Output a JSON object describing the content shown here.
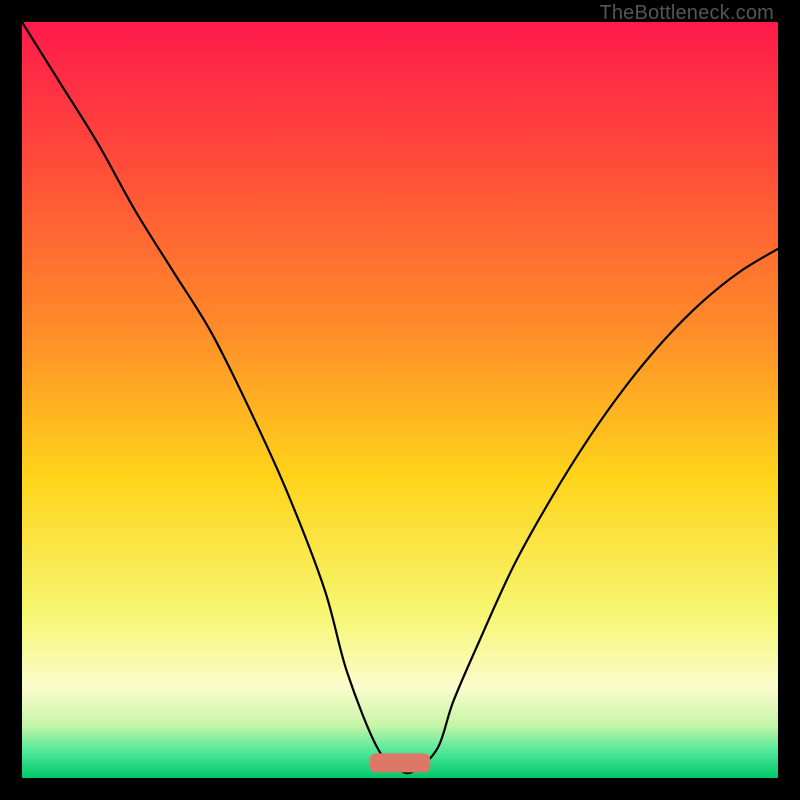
{
  "watermark": "TheBottleneck.com",
  "chart_data": {
    "type": "line",
    "title": "",
    "xlabel": "",
    "ylabel": "",
    "xlim": [
      0,
      100
    ],
    "ylim": [
      0,
      100
    ],
    "grid": false,
    "legend": false,
    "series": [
      {
        "name": "curve",
        "x": [
          0,
          5,
          10,
          15,
          20,
          25,
          30,
          35,
          40,
          43,
          47,
          50,
          52,
          55,
          57,
          60,
          65,
          70,
          75,
          80,
          85,
          90,
          95,
          100
        ],
        "y": [
          100,
          92,
          84,
          75,
          67,
          59,
          49,
          38,
          25,
          14,
          4,
          1,
          1,
          4,
          10,
          17,
          28,
          37,
          45,
          52,
          58,
          63,
          67,
          70
        ]
      }
    ],
    "marker": {
      "x": 50,
      "y": 2,
      "width": 8,
      "height": 2.5,
      "color": "#dd7766"
    },
    "background_gradient": {
      "stops": [
        {
          "offset": 0.0,
          "color": "#ff1a4b"
        },
        {
          "offset": 0.18,
          "color": "#ff4a3a"
        },
        {
          "offset": 0.4,
          "color": "#ff8a2a"
        },
        {
          "offset": 0.6,
          "color": "#ffd31a"
        },
        {
          "offset": 0.78,
          "color": "#f6f670"
        },
        {
          "offset": 0.88,
          "color": "#fbfccc"
        },
        {
          "offset": 0.93,
          "color": "#c7f5a8"
        },
        {
          "offset": 0.965,
          "color": "#4fe89a"
        },
        {
          "offset": 1.0,
          "color": "#00c76a"
        }
      ]
    }
  }
}
